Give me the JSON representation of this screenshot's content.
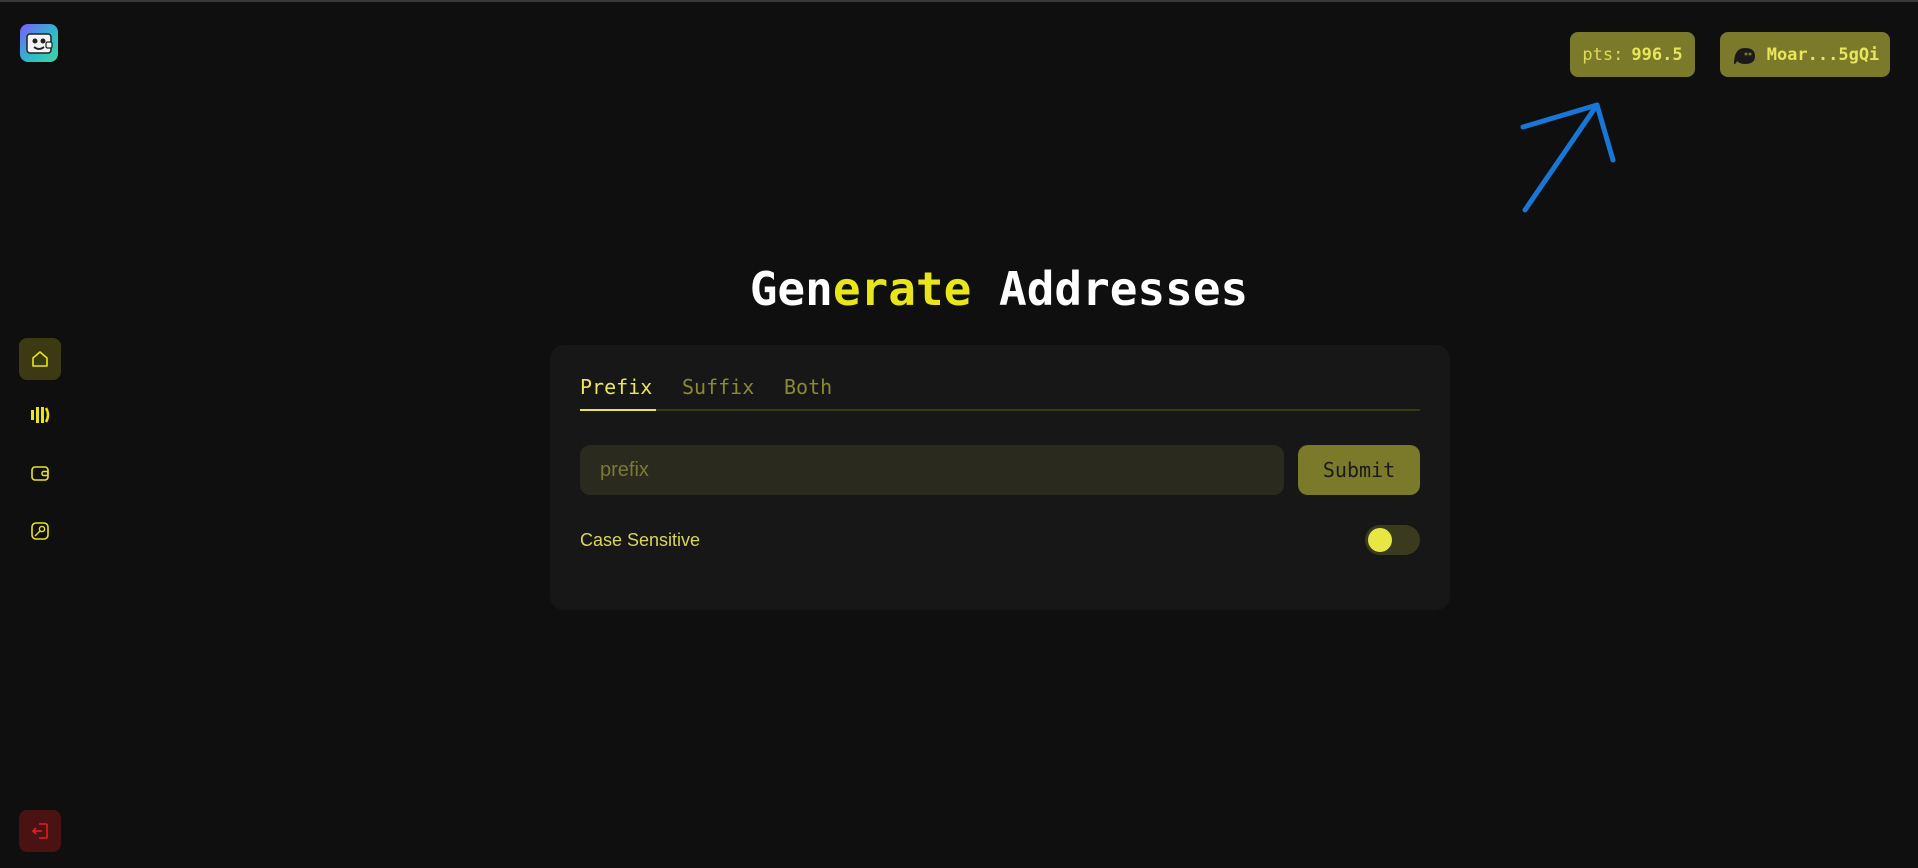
{
  "header": {
    "points_label": "pts:",
    "points_value": "996.5",
    "wallet_short": "Moar...5gQi"
  },
  "main": {
    "title_part1": "Gen",
    "title_part2": "erate",
    "title_part3": " Addresses",
    "tabs": [
      {
        "label": "Prefix",
        "active": true
      },
      {
        "label": "Suffix",
        "active": false
      },
      {
        "label": "Both",
        "active": false
      }
    ],
    "input": {
      "placeholder": "prefix",
      "value": ""
    },
    "submit_label": "Submit",
    "case_sensitive_label": "Case Sensitive",
    "case_sensitive": false
  },
  "sidebar": {
    "items": [
      {
        "icon": "home-icon",
        "active": true
      },
      {
        "icon": "stats-icon",
        "active": false
      },
      {
        "icon": "wallet-icon",
        "active": false
      },
      {
        "icon": "key-icon",
        "active": false
      }
    ],
    "logout_icon": "logout-icon"
  },
  "colors": {
    "accent": "#e8e61a",
    "background": "#0f0f0f",
    "card": "#171717",
    "arrow": "#1877d6"
  }
}
